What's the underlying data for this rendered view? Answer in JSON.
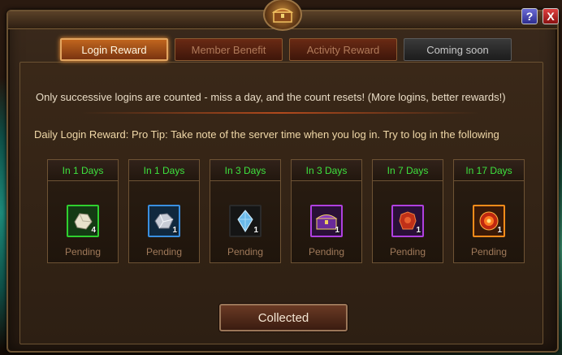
{
  "tabs": [
    {
      "label": "Login Reward"
    },
    {
      "label": "Member Benefit"
    },
    {
      "label": "Activity Reward"
    },
    {
      "label": "Coming soon"
    }
  ],
  "controls": {
    "help": "?",
    "close": "X"
  },
  "intro": "Only successive logins are counted - miss a day, and the count resets! (More logins, better rewards!)",
  "tip": "Daily Login Reward:  Pro Tip: Take note of the server time when you log in. Try to log in the following",
  "rewards": [
    {
      "days": "In 1 Days",
      "qty": "4",
      "status": "Pending",
      "icon": "white-ore-icon",
      "frame": "#2fd02f"
    },
    {
      "days": "In 1 Days",
      "qty": "1",
      "status": "Pending",
      "icon": "silver-ore-icon",
      "frame": "#3a8fe0"
    },
    {
      "days": "In 3 Days",
      "qty": "1",
      "status": "Pending",
      "icon": "blue-crystal-icon",
      "frame": "#2a2a2a"
    },
    {
      "days": "In 3 Days",
      "qty": "1",
      "status": "Pending",
      "icon": "treasure-chest-icon",
      "frame": "#b040e0"
    },
    {
      "days": "In 7 Days",
      "qty": "1",
      "status": "Pending",
      "icon": "red-armor-icon",
      "frame": "#b040e0"
    },
    {
      "days": "In 17 Days",
      "qty": "1",
      "status": "Pending",
      "icon": "fire-orb-icon",
      "frame": "#ff8c1a"
    }
  ],
  "collect_button": "Collected"
}
